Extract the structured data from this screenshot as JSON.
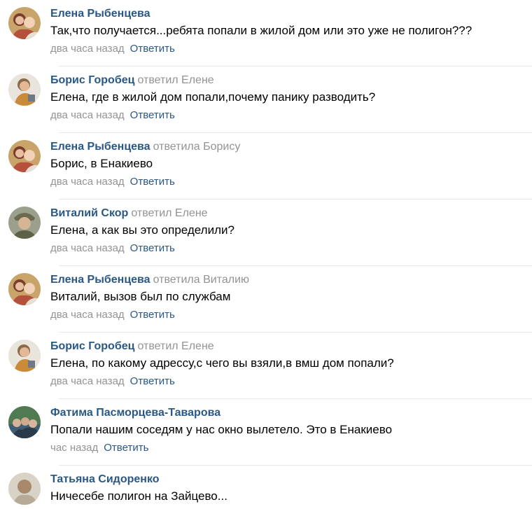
{
  "reply_label": "Ответить",
  "comments": [
    {
      "author": "Елена Рыбенцева",
      "reply_to": "",
      "text": "Так,что получается...ребята попали в жилой дом или это уже не полигон???",
      "time": "два часа назад"
    },
    {
      "author": "Борис Горобец",
      "reply_to": "ответил Елене",
      "text": "Елена, где в жилой дом попали,почему панику разводить?",
      "time": "два часа назад"
    },
    {
      "author": "Елена Рыбенцева",
      "reply_to": "ответила Борису",
      "text": "Борис, в Енакиево",
      "time": "два часа назад"
    },
    {
      "author": "Виталий Скор",
      "reply_to": "ответил Елене",
      "text": "Елена, а как вы это определили?",
      "time": "два часа назад"
    },
    {
      "author": "Елена Рыбенцева",
      "reply_to": "ответила Виталию",
      "text": "Виталий, вызов был по службам",
      "time": "два часа назад"
    },
    {
      "author": "Борис Горобец",
      "reply_to": "ответил Елене",
      "text": "Елена, по какому адрессу,с чего вы взяли,в вмш дом попали?",
      "time": "два часа назад"
    },
    {
      "author": "Фатима Пасморцева-Таварова",
      "reply_to": "",
      "text": "Попали нашим соседям у нас окно вылетело. Это в Енакиево",
      "time": "час назад"
    },
    {
      "author": "Татьяна Сидоренко",
      "reply_to": "",
      "text": "Ничесебе полигон на Зайцево...",
      "time": ""
    }
  ]
}
